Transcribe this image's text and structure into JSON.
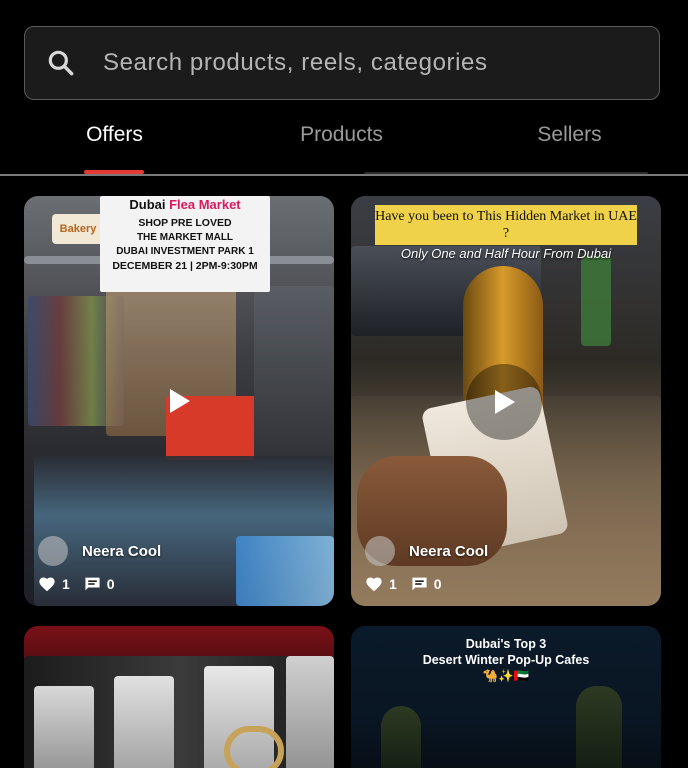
{
  "search": {
    "placeholder": "Search products, reels, categories",
    "icon": "search-icon"
  },
  "tabs": [
    {
      "label": "Offers",
      "active": true
    },
    {
      "label": "Products",
      "active": false
    },
    {
      "label": "Sellers",
      "active": false
    }
  ],
  "colors": {
    "accent": "#e53935",
    "background": "#000000",
    "inactive_tab": "#9a9a9a"
  },
  "reels": [
    {
      "poster": {
        "title_a": "Dubai ",
        "title_b": "Flea Market",
        "line1": "SHOP PRE LOVED",
        "line2": "THE MARKET MALL",
        "line3": "DUBAI INVESTMENT PARK 1",
        "line4": "DECEMBER 21 | 2PM-9:30PM"
      },
      "store_sign": "Bakery",
      "author": "Neera Cool",
      "likes": "1",
      "comments": "0"
    },
    {
      "banner": "Have you been to This Hidden Market in UAE ?",
      "subbanner": "Only One and Half Hour From Dubai",
      "author": "Neera Cool",
      "likes": "1",
      "comments": "0"
    },
    {},
    {
      "title_line1": "Dubai's Top 3",
      "title_line2": "Desert Winter Pop-Up Cafes",
      "emoji": "🐪✨🇦🇪"
    }
  ]
}
